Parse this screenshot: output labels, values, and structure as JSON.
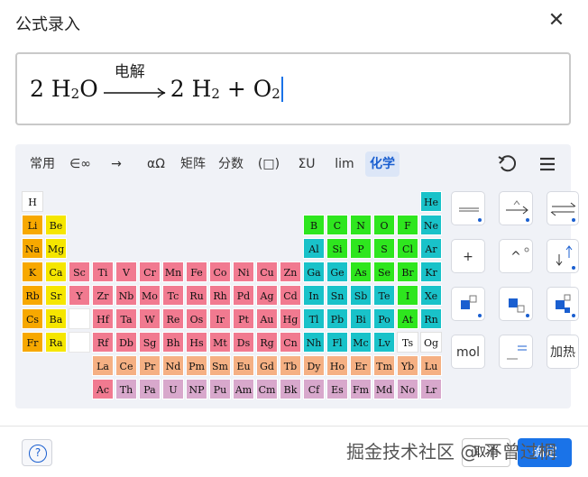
{
  "dialog": {
    "title": "公式录入",
    "close_glyph": "✕"
  },
  "formula": {
    "coef1": "2",
    "h2o_h": "H",
    "h2o_sub": "2",
    "h2o_o": "O",
    "arrow_label": "电解",
    "coef2": "2",
    "h2_h": "H",
    "h2_sub": "2",
    "plus": "+",
    "o2_o": "O",
    "o2_sub": "2"
  },
  "tabs": [
    {
      "label": "常用"
    },
    {
      "label": "∈∞"
    },
    {
      "label": "→"
    },
    {
      "label": "αΩ"
    },
    {
      "label": "矩阵"
    },
    {
      "label": "分数"
    },
    {
      "label": "(□)"
    },
    {
      "label": "ΣU"
    },
    {
      "label": "lim"
    },
    {
      "label": "化学",
      "active": true
    }
  ],
  "toolbar_icons": {
    "undo": "undo-icon",
    "menu": "menu-icon"
  },
  "colors": {
    "alkali": "#f7a800",
    "alkaline": "#f5e600",
    "transition": "#f17a90",
    "nonmetal": "#2ee61e",
    "metalloid": "#19c2c9",
    "post_transition": "#19c2c9",
    "halogen": "#2ee61e",
    "noble": "#19c2c9",
    "lanthanide": "#f5b083",
    "actinide": "#d8a8cc",
    "hydrogen": "#ffffff",
    "unknown": "#ffffff",
    "accent": "#1a73e8"
  },
  "periodic_table": [
    {
      "s": "H",
      "r": 0,
      "c": 0,
      "t": "hydrogen"
    },
    {
      "s": "He",
      "r": 0,
      "c": 17,
      "t": "noble"
    },
    {
      "s": "Li",
      "r": 1,
      "c": 0,
      "t": "alkali"
    },
    {
      "s": "Be",
      "r": 1,
      "c": 1,
      "t": "alkaline"
    },
    {
      "s": "B",
      "r": 1,
      "c": 12,
      "t": "nonmetal"
    },
    {
      "s": "C",
      "r": 1,
      "c": 13,
      "t": "nonmetal"
    },
    {
      "s": "N",
      "r": 1,
      "c": 14,
      "t": "nonmetal"
    },
    {
      "s": "O",
      "r": 1,
      "c": 15,
      "t": "nonmetal"
    },
    {
      "s": "F",
      "r": 1,
      "c": 16,
      "t": "nonmetal"
    },
    {
      "s": "Ne",
      "r": 1,
      "c": 17,
      "t": "noble"
    },
    {
      "s": "Na",
      "r": 2,
      "c": 0,
      "t": "alkali"
    },
    {
      "s": "Mg",
      "r": 2,
      "c": 1,
      "t": "alkaline"
    },
    {
      "s": "Al",
      "r": 2,
      "c": 12,
      "t": "metalloid"
    },
    {
      "s": "Si",
      "r": 2,
      "c": 13,
      "t": "nonmetal"
    },
    {
      "s": "P",
      "r": 2,
      "c": 14,
      "t": "nonmetal"
    },
    {
      "s": "S",
      "r": 2,
      "c": 15,
      "t": "nonmetal"
    },
    {
      "s": "Cl",
      "r": 2,
      "c": 16,
      "t": "nonmetal"
    },
    {
      "s": "Ar",
      "r": 2,
      "c": 17,
      "t": "noble"
    },
    {
      "s": "K",
      "r": 3,
      "c": 0,
      "t": "alkali"
    },
    {
      "s": "Ca",
      "r": 3,
      "c": 1,
      "t": "alkaline"
    },
    {
      "s": "Sc",
      "r": 3,
      "c": 2,
      "t": "transition"
    },
    {
      "s": "Ti",
      "r": 3,
      "c": 3,
      "t": "transition"
    },
    {
      "s": "V",
      "r": 3,
      "c": 4,
      "t": "transition"
    },
    {
      "s": "Cr",
      "r": 3,
      "c": 5,
      "t": "transition"
    },
    {
      "s": "Mn",
      "r": 3,
      "c": 6,
      "t": "transition"
    },
    {
      "s": "Fe",
      "r": 3,
      "c": 7,
      "t": "transition"
    },
    {
      "s": "Co",
      "r": 3,
      "c": 8,
      "t": "transition"
    },
    {
      "s": "Ni",
      "r": 3,
      "c": 9,
      "t": "transition"
    },
    {
      "s": "Cu",
      "r": 3,
      "c": 10,
      "t": "transition"
    },
    {
      "s": "Zn",
      "r": 3,
      "c": 11,
      "t": "transition"
    },
    {
      "s": "Ga",
      "r": 3,
      "c": 12,
      "t": "metalloid"
    },
    {
      "s": "Ge",
      "r": 3,
      "c": 13,
      "t": "metalloid"
    },
    {
      "s": "As",
      "r": 3,
      "c": 14,
      "t": "nonmetal"
    },
    {
      "s": "Se",
      "r": 3,
      "c": 15,
      "t": "nonmetal"
    },
    {
      "s": "Br",
      "r": 3,
      "c": 16,
      "t": "nonmetal"
    },
    {
      "s": "Kr",
      "r": 3,
      "c": 17,
      "t": "noble"
    },
    {
      "s": "Rb",
      "r": 4,
      "c": 0,
      "t": "alkali"
    },
    {
      "s": "Sr",
      "r": 4,
      "c": 1,
      "t": "alkaline"
    },
    {
      "s": "Y",
      "r": 4,
      "c": 2,
      "t": "transition"
    },
    {
      "s": "Zr",
      "r": 4,
      "c": 3,
      "t": "transition"
    },
    {
      "s": "Nb",
      "r": 4,
      "c": 4,
      "t": "transition"
    },
    {
      "s": "Mo",
      "r": 4,
      "c": 5,
      "t": "transition"
    },
    {
      "s": "Tc",
      "r": 4,
      "c": 6,
      "t": "transition"
    },
    {
      "s": "Ru",
      "r": 4,
      "c": 7,
      "t": "transition"
    },
    {
      "s": "Rh",
      "r": 4,
      "c": 8,
      "t": "transition"
    },
    {
      "s": "Pd",
      "r": 4,
      "c": 9,
      "t": "transition"
    },
    {
      "s": "Ag",
      "r": 4,
      "c": 10,
      "t": "transition"
    },
    {
      "s": "Cd",
      "r": 4,
      "c": 11,
      "t": "transition"
    },
    {
      "s": "In",
      "r": 4,
      "c": 12,
      "t": "metalloid"
    },
    {
      "s": "Sn",
      "r": 4,
      "c": 13,
      "t": "metalloid"
    },
    {
      "s": "Sb",
      "r": 4,
      "c": 14,
      "t": "metalloid"
    },
    {
      "s": "Te",
      "r": 4,
      "c": 15,
      "t": "metalloid"
    },
    {
      "s": "I",
      "r": 4,
      "c": 16,
      "t": "nonmetal"
    },
    {
      "s": "Xe",
      "r": 4,
      "c": 17,
      "t": "noble"
    },
    {
      "s": "Cs",
      "r": 5,
      "c": 0,
      "t": "alkali"
    },
    {
      "s": "Ba",
      "r": 5,
      "c": 1,
      "t": "alkaline"
    },
    {
      "s": "Hf",
      "r": 5,
      "c": 3,
      "t": "transition"
    },
    {
      "s": "Ta",
      "r": 5,
      "c": 4,
      "t": "transition"
    },
    {
      "s": "W",
      "r": 5,
      "c": 5,
      "t": "transition"
    },
    {
      "s": "Re",
      "r": 5,
      "c": 6,
      "t": "transition"
    },
    {
      "s": "Os",
      "r": 5,
      "c": 7,
      "t": "transition"
    },
    {
      "s": "Ir",
      "r": 5,
      "c": 8,
      "t": "transition"
    },
    {
      "s": "Pt",
      "r": 5,
      "c": 9,
      "t": "transition"
    },
    {
      "s": "Au",
      "r": 5,
      "c": 10,
      "t": "transition"
    },
    {
      "s": "Hg",
      "r": 5,
      "c": 11,
      "t": "transition"
    },
    {
      "s": "Tl",
      "r": 5,
      "c": 12,
      "t": "metalloid"
    },
    {
      "s": "Pb",
      "r": 5,
      "c": 13,
      "t": "metalloid"
    },
    {
      "s": "Bi",
      "r": 5,
      "c": 14,
      "t": "metalloid"
    },
    {
      "s": "Po",
      "r": 5,
      "c": 15,
      "t": "metalloid"
    },
    {
      "s": "At",
      "r": 5,
      "c": 16,
      "t": "nonmetal"
    },
    {
      "s": "Rn",
      "r": 5,
      "c": 17,
      "t": "noble"
    },
    {
      "s": "Fr",
      "r": 6,
      "c": 0,
      "t": "alkali"
    },
    {
      "s": "Ra",
      "r": 6,
      "c": 1,
      "t": "alkaline"
    },
    {
      "s": "Rf",
      "r": 6,
      "c": 3,
      "t": "transition"
    },
    {
      "s": "Db",
      "r": 6,
      "c": 4,
      "t": "transition"
    },
    {
      "s": "Sg",
      "r": 6,
      "c": 5,
      "t": "transition"
    },
    {
      "s": "Bh",
      "r": 6,
      "c": 6,
      "t": "transition"
    },
    {
      "s": "Hs",
      "r": 6,
      "c": 7,
      "t": "transition"
    },
    {
      "s": "Mt",
      "r": 6,
      "c": 8,
      "t": "transition"
    },
    {
      "s": "Ds",
      "r": 6,
      "c": 9,
      "t": "transition"
    },
    {
      "s": "Rg",
      "r": 6,
      "c": 10,
      "t": "transition"
    },
    {
      "s": "Cn",
      "r": 6,
      "c": 11,
      "t": "transition"
    },
    {
      "s": "Nh",
      "r": 6,
      "c": 12,
      "t": "metalloid"
    },
    {
      "s": "Fl",
      "r": 6,
      "c": 13,
      "t": "metalloid"
    },
    {
      "s": "Mc",
      "r": 6,
      "c": 14,
      "t": "metalloid"
    },
    {
      "s": "Lv",
      "r": 6,
      "c": 15,
      "t": "metalloid"
    },
    {
      "s": "Ts",
      "r": 6,
      "c": 16,
      "t": "unknown"
    },
    {
      "s": "Og",
      "r": 6,
      "c": 17,
      "t": "unknown"
    },
    {
      "s": "La",
      "r": 7,
      "c": 3,
      "t": "lanthanide"
    },
    {
      "s": "Ce",
      "r": 7,
      "c": 4,
      "t": "lanthanide"
    },
    {
      "s": "Pr",
      "r": 7,
      "c": 5,
      "t": "lanthanide"
    },
    {
      "s": "Nd",
      "r": 7,
      "c": 6,
      "t": "lanthanide"
    },
    {
      "s": "Pm",
      "r": 7,
      "c": 7,
      "t": "lanthanide"
    },
    {
      "s": "Sm",
      "r": 7,
      "c": 8,
      "t": "lanthanide"
    },
    {
      "s": "Eu",
      "r": 7,
      "c": 9,
      "t": "lanthanide"
    },
    {
      "s": "Gd",
      "r": 7,
      "c": 10,
      "t": "lanthanide"
    },
    {
      "s": "Tb",
      "r": 7,
      "c": 11,
      "t": "lanthanide"
    },
    {
      "s": "Dy",
      "r": 7,
      "c": 12,
      "t": "lanthanide"
    },
    {
      "s": "Ho",
      "r": 7,
      "c": 13,
      "t": "lanthanide"
    },
    {
      "s": "Er",
      "r": 7,
      "c": 14,
      "t": "lanthanide"
    },
    {
      "s": "Tm",
      "r": 7,
      "c": 15,
      "t": "lanthanide"
    },
    {
      "s": "Yb",
      "r": 7,
      "c": 16,
      "t": "lanthanide"
    },
    {
      "s": "Lu",
      "r": 7,
      "c": 17,
      "t": "lanthanide"
    },
    {
      "s": "Ac",
      "r": 8,
      "c": 3,
      "t": "transition"
    },
    {
      "s": "Th",
      "r": 8,
      "c": 4,
      "t": "actinide"
    },
    {
      "s": "Pa",
      "r": 8,
      "c": 5,
      "t": "actinide"
    },
    {
      "s": "U",
      "r": 8,
      "c": 6,
      "t": "actinide"
    },
    {
      "s": "NP",
      "r": 8,
      "c": 7,
      "t": "actinide"
    },
    {
      "s": "Pu",
      "r": 8,
      "c": 8,
      "t": "actinide"
    },
    {
      "s": "Am",
      "r": 8,
      "c": 9,
      "t": "actinide"
    },
    {
      "s": "Cm",
      "r": 8,
      "c": 10,
      "t": "actinide"
    },
    {
      "s": "Bk",
      "r": 8,
      "c": 11,
      "t": "actinide"
    },
    {
      "s": "Cf",
      "r": 8,
      "c": 12,
      "t": "actinide"
    },
    {
      "s": "Es",
      "r": 8,
      "c": 13,
      "t": "actinide"
    },
    {
      "s": "Fm",
      "r": 8,
      "c": 14,
      "t": "actinide"
    },
    {
      "s": "Md",
      "r": 8,
      "c": 15,
      "t": "actinide"
    },
    {
      "s": "No",
      "r": 8,
      "c": 16,
      "t": "actinide"
    },
    {
      "s": "Lr",
      "r": 8,
      "c": 17,
      "t": "actinide"
    }
  ],
  "side_buttons": {
    "b3_text": "+",
    "b4_text": "^",
    "b10_text": "mol",
    "b12_text": "加热"
  },
  "footer": {
    "help_glyph": "?",
    "watermark": "掘金技术社区 @ 不曾过桐",
    "cancel_label": "取消",
    "ok_label": "确定"
  }
}
